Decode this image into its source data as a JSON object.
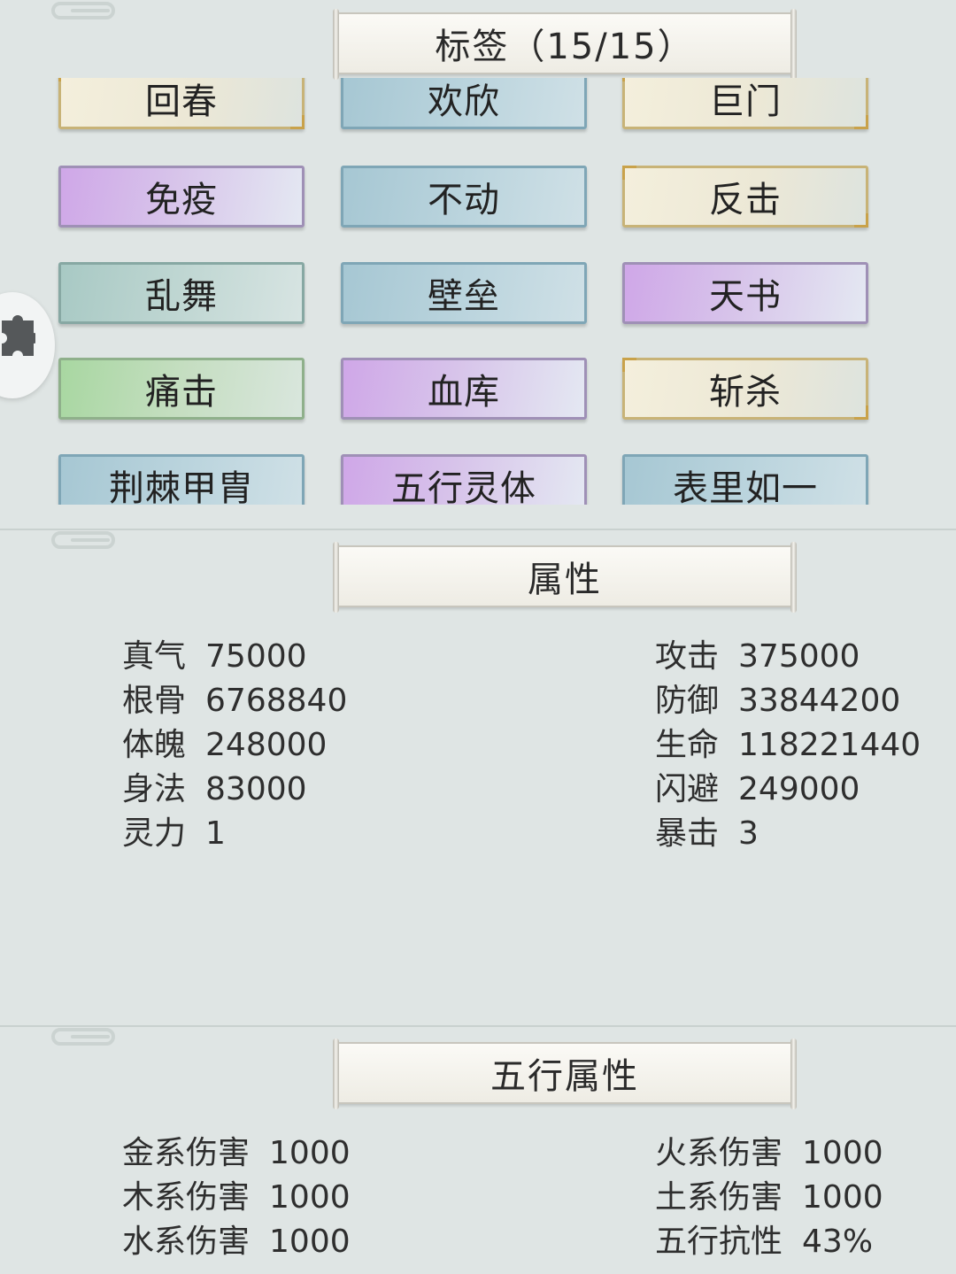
{
  "tags": {
    "title": "标签（15/15）",
    "items": [
      {
        "label": "回春",
        "style": "gold"
      },
      {
        "label": "欢欣",
        "style": "blue"
      },
      {
        "label": "巨门",
        "style": "gold"
      },
      {
        "label": "免疫",
        "style": "purple"
      },
      {
        "label": "不动",
        "style": "blue"
      },
      {
        "label": "反击",
        "style": "gold"
      },
      {
        "label": "乱舞",
        "style": "teal"
      },
      {
        "label": "壁垒",
        "style": "blue"
      },
      {
        "label": "天书",
        "style": "purple"
      },
      {
        "label": "痛击",
        "style": "green"
      },
      {
        "label": "血库",
        "style": "purple"
      },
      {
        "label": "斩杀",
        "style": "gold"
      },
      {
        "label": "荆棘甲胄",
        "style": "blue"
      },
      {
        "label": "五行灵体",
        "style": "purple"
      },
      {
        "label": "表里如一",
        "style": "blue"
      }
    ]
  },
  "attributes": {
    "title": "属性",
    "left": [
      {
        "label": "真气",
        "value": "75000"
      },
      {
        "label": "根骨",
        "value": "6768840"
      },
      {
        "label": "体魄",
        "value": "248000"
      },
      {
        "label": "身法",
        "value": "83000"
      },
      {
        "label": "灵力",
        "value": "1"
      }
    ],
    "right": [
      {
        "label": "攻击",
        "value": "375000"
      },
      {
        "label": "防御",
        "value": "33844200"
      },
      {
        "label": "生命",
        "value": "118221440"
      },
      {
        "label": "闪避",
        "value": "249000"
      },
      {
        "label": "暴击",
        "value": "3"
      }
    ]
  },
  "elements": {
    "title": "五行属性",
    "left": [
      {
        "label": "金系伤害",
        "value": "1000"
      },
      {
        "label": "木系伤害",
        "value": "1000"
      },
      {
        "label": "水系伤害",
        "value": "1000"
      }
    ],
    "right": [
      {
        "label": "火系伤害",
        "value": "1000"
      },
      {
        "label": "土系伤害",
        "value": "1000"
      },
      {
        "label": "五行抗性",
        "value": "43%"
      }
    ]
  },
  "icons": {
    "float_button": "puzzle-icon"
  },
  "colors": {
    "background": "#dfe5e4",
    "gold_tag": "#c8b377",
    "blue_tag": "#a6c7d3",
    "purple_tag": "#cfa7e8",
    "teal_tag": "#a8c9c4",
    "green_tag": "#a8d7a1"
  }
}
